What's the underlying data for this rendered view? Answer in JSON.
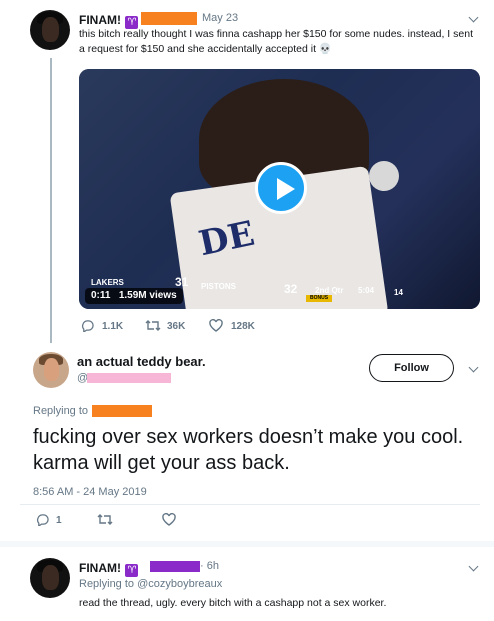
{
  "tweet1": {
    "name": "FINAM!",
    "zodiac": "♈",
    "date": "May 23",
    "text": "this bitch really thought I was finna cashapp her $150 for some nudes. instead, I sent a request for $150 and she accidentally accepted it 💀",
    "video": {
      "time": "0:11",
      "views": "1.59M views",
      "jersey_text": "DE",
      "team1": "LAKERS",
      "team1_score": "31",
      "team2": "PISTONS",
      "team2_score": "32",
      "quarter": "2nd Qtr",
      "clock": "5:04",
      "shot_clock": "14",
      "bonus": "BONUS"
    },
    "replies": "1.1K",
    "retweets": "36K",
    "likes": "128K"
  },
  "tweet2": {
    "name": "an actual teddy bear.",
    "handle_prefix": "@",
    "follow_label": "Follow",
    "replying_to": "Replying to",
    "text": "fucking over sex workers doesn’t make you cool. karma will get your ass back.",
    "timestamp": "8:56 AM - 24 May 2019",
    "replies": "1"
  },
  "tweet3": {
    "name": "FINAM!",
    "zodiac": "♈",
    "time": "· 6h",
    "replying_to": "Replying to @cozyboybreaux",
    "text": "read the thread, ugly. every bitch with a cashapp not a sex worker."
  },
  "icons": {
    "reply": "reply-icon",
    "retweet": "retweet-icon",
    "like": "heart-icon",
    "chevron": "chevron-down-icon",
    "play": "play-icon"
  },
  "colors": {
    "accent": "#1da1f2",
    "redact_orange": "#f7801f",
    "redact_purple": "#8a2bc9",
    "redact_pink": "#f7b6d6"
  }
}
